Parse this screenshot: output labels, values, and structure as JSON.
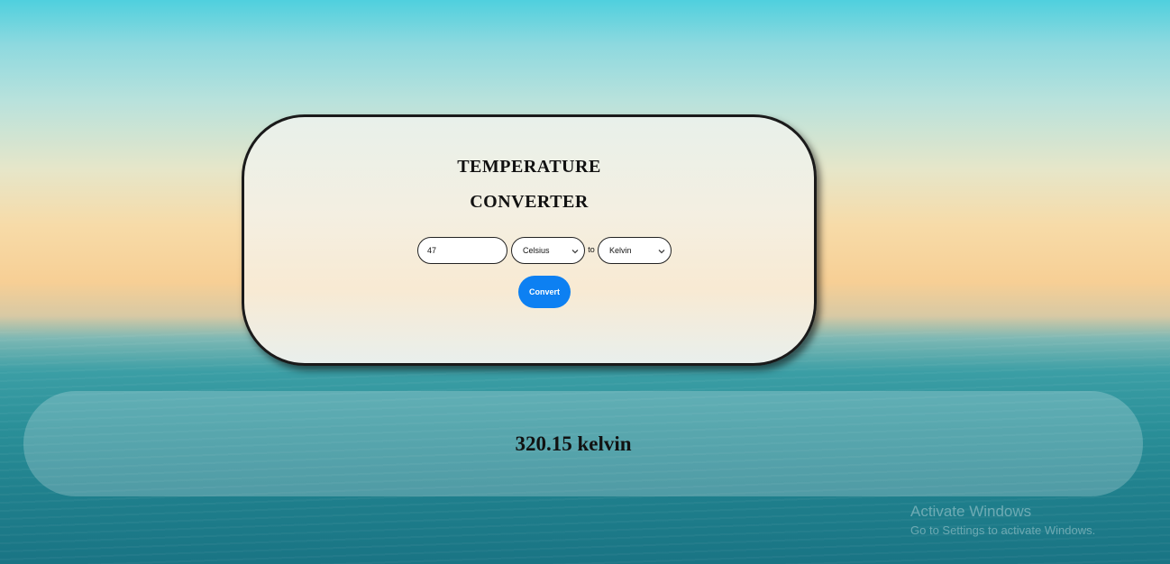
{
  "converter": {
    "title_line1": "TEMPERATURE",
    "title_line2": "CONVERTER",
    "input_value": "47",
    "from_unit": "Celsius",
    "to_label": "to",
    "to_unit": "Kelvin",
    "convert_label": "Convert"
  },
  "result": {
    "text": "320.15 kelvin"
  },
  "watermark": {
    "line1": "Activate Windows",
    "line2": "Go to Settings to activate Windows."
  },
  "colors": {
    "accent": "#0d80f2"
  }
}
